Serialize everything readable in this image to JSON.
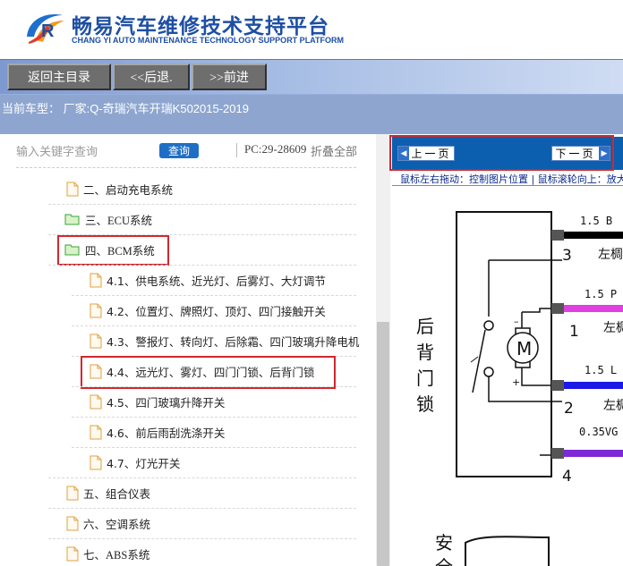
{
  "header": {
    "title_cn": "畅易汽车维修技术支持平台",
    "title_en": "CHANG YI AUTO MAINTENANCE TECHNOLOGY SUPPORT PLATFORM",
    "logo_icon": "cy-logo-icon"
  },
  "toolbar": {
    "home_label": "返回主目录",
    "back_label": "<<后退.",
    "forward_label": ">>前进"
  },
  "vehicle": {
    "text": "当前车型： 厂家:Q-奇瑞汽车开瑞K502015-2019"
  },
  "search": {
    "placeholder": "输入关键字查询",
    "query_label": "查询",
    "pc_code": "PC:29-28609",
    "collapse_label": "折叠全部"
  },
  "tree": {
    "items": [
      {
        "label": "二、启动充电系统",
        "icon": "file-icon"
      },
      {
        "label": "三、ECU系统",
        "icon": "folder-open-icon"
      },
      {
        "label": "四、BCM系统",
        "icon": "folder-open-icon"
      },
      {
        "label": "4.1、供电系统、近光灯、后雾灯、大灯调节",
        "icon": "file-icon"
      },
      {
        "label": "4.2、位置灯、牌照灯、顶灯、四门接触开关",
        "icon": "file-icon"
      },
      {
        "label": "4.3、警报灯、转向灯、后除霜、四门玻璃升降电机",
        "icon": "file-icon"
      },
      {
        "label": "4.4、远光灯、雾灯、四门门锁、后背门锁",
        "icon": "file-icon"
      },
      {
        "label": "4.5、四门玻璃升降开关",
        "icon": "file-icon"
      },
      {
        "label": "4.6、前后雨刮洗涤开关",
        "icon": "file-icon"
      },
      {
        "label": "4.7、灯光开关",
        "icon": "file-icon"
      },
      {
        "label": "五、组合仪表",
        "icon": "file-icon"
      },
      {
        "label": "六、空调系统",
        "icon": "file-icon"
      },
      {
        "label": "七、ABS系统",
        "icon": "file-icon"
      }
    ]
  },
  "viewer": {
    "prev_label": "上一页",
    "next_label": "下一页",
    "hint": "鼠标左右拖动：控制图片位置 | 鼠标滚轮向上：放大"
  },
  "diagram": {
    "title_chars": [
      "后",
      "背",
      "门",
      "锁"
    ],
    "bottom_chars": [
      "安",
      "全"
    ],
    "motor_label": "M",
    "wires": [
      {
        "spec": "1.5 B",
        "pin": "3",
        "side": "左椆",
        "color": "#000000"
      },
      {
        "spec": "1.5 P",
        "pin": "1",
        "side": "左椆",
        "color": "#e040e0"
      },
      {
        "spec": "1.5 L",
        "pin": "2",
        "side": "左椆",
        "color": "#1a1ae6"
      },
      {
        "spec": "0.35VG",
        "pin": "4",
        "side": "左椆",
        "color": "#7d2ad6"
      }
    ]
  },
  "colors": {
    "brand_blue": "#1d4fa3",
    "highlight_red": "#d2282e",
    "nav_blue": "#0b5fae"
  }
}
